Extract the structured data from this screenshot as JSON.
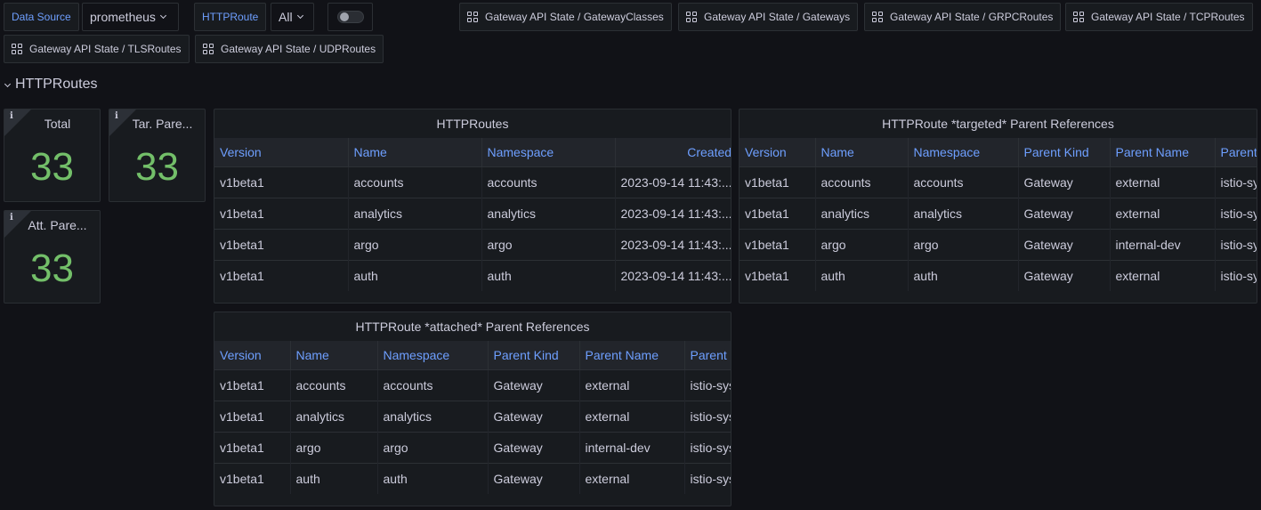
{
  "variables": {
    "datasource_label": "Data Source",
    "datasource_value": "prometheus",
    "httproute_label": "HTTPRoute",
    "httproute_value": "All"
  },
  "links": [
    "Gateway API State / GatewayClasses",
    "Gateway API State / Gateways",
    "Gateway API State / GRPCRoutes",
    "Gateway API State / TCPRoutes",
    "Gateway API State / TLSRoutes",
    "Gateway API State / UDPRoutes"
  ],
  "row": {
    "title": "HTTPRoutes"
  },
  "stats": {
    "total": {
      "title": "Total",
      "value": "33"
    },
    "targeted": {
      "title": "Tar. Pare...",
      "value": "33"
    },
    "attached": {
      "title": "Att. Pare...",
      "value": "33"
    }
  },
  "httproutes_table": {
    "title": "HTTPRoutes",
    "columns": [
      "Version",
      "Name",
      "Namespace",
      "Created A"
    ],
    "rows": [
      [
        "v1beta1",
        "accounts",
        "accounts",
        "2023-09-14 11:43:..."
      ],
      [
        "v1beta1",
        "analytics",
        "analytics",
        "2023-09-14 11:43:..."
      ],
      [
        "v1beta1",
        "argo",
        "argo",
        "2023-09-14 11:43:..."
      ],
      [
        "v1beta1",
        "auth",
        "auth",
        "2023-09-14 11:43:..."
      ]
    ]
  },
  "targeted_table": {
    "title": "HTTPRoute *targeted* Parent References",
    "columns": [
      "Version",
      "Name",
      "Namespace",
      "Parent Kind",
      "Parent Name",
      "Parent N"
    ],
    "rows": [
      [
        "v1beta1",
        "accounts",
        "accounts",
        "Gateway",
        "external",
        "istio-sys"
      ],
      [
        "v1beta1",
        "analytics",
        "analytics",
        "Gateway",
        "external",
        "istio-sys"
      ],
      [
        "v1beta1",
        "argo",
        "argo",
        "Gateway",
        "internal-dev",
        "istio-sys"
      ],
      [
        "v1beta1",
        "auth",
        "auth",
        "Gateway",
        "external",
        "istio-sys"
      ]
    ]
  },
  "attached_table": {
    "title": "HTTPRoute *attached* Parent References",
    "columns": [
      "Version",
      "Name",
      "Namespace",
      "Parent Kind",
      "Parent Name",
      "Parent N"
    ],
    "rows": [
      [
        "v1beta1",
        "accounts",
        "accounts",
        "Gateway",
        "external",
        "istio-sys"
      ],
      [
        "v1beta1",
        "analytics",
        "analytics",
        "Gateway",
        "external",
        "istio-sys"
      ],
      [
        "v1beta1",
        "argo",
        "argo",
        "Gateway",
        "internal-dev",
        "istio-sys"
      ],
      [
        "v1beta1",
        "auth",
        "auth",
        "Gateway",
        "external",
        "istio-sys"
      ]
    ]
  }
}
